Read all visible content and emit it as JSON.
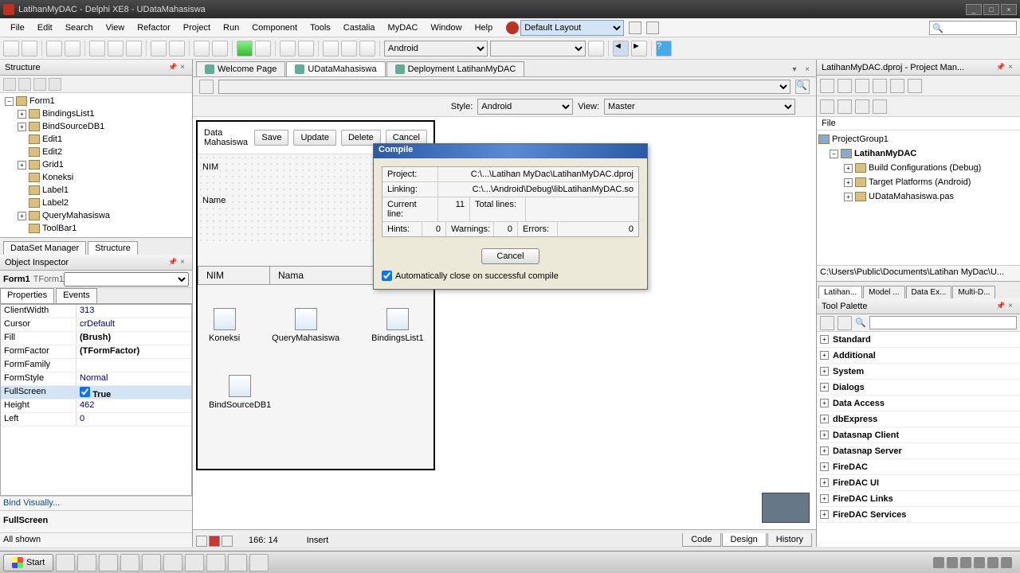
{
  "window_title": "LatihanMyDAC - Delphi XE8 - UDataMahasiswa",
  "menus": [
    "File",
    "Edit",
    "Search",
    "View",
    "Refactor",
    "Project",
    "Run",
    "Component",
    "Tools",
    "Castalia",
    "MyDAC",
    "Window",
    "Help"
  ],
  "layout_combo": "Default Layout",
  "target_combo": "Android",
  "structure": {
    "title": "Structure",
    "root": "Form1",
    "items": [
      "BindingsList1",
      "BindSourceDB1",
      "Edit1",
      "Edit2",
      "Grid1",
      "Koneksi",
      "Label1",
      "Label2",
      "QueryMahasiswa",
      "ToolBar1"
    ],
    "tabs": [
      "DataSet Manager",
      "Structure"
    ]
  },
  "inspector": {
    "title": "Object Inspector",
    "obj_name": "Form1",
    "obj_type": "TForm1",
    "tabs": [
      "Properties",
      "Events"
    ],
    "props": [
      {
        "n": "ClientWidth",
        "v": "313"
      },
      {
        "n": "Cursor",
        "v": "crDefault"
      },
      {
        "n": "Fill",
        "v": "(Brush)",
        "b": true
      },
      {
        "n": "FormFactor",
        "v": "(TFormFactor)",
        "b": true
      },
      {
        "n": "FormFamily",
        "v": ""
      },
      {
        "n": "FormStyle",
        "v": "Normal"
      },
      {
        "n": "FullScreen",
        "v": "True",
        "sel": true,
        "b": true,
        "chk": true
      },
      {
        "n": "Height",
        "v": "462"
      },
      {
        "n": "Left",
        "v": "0"
      }
    ],
    "bind_link": "Bind Visually...",
    "selected_prop": "FullScreen",
    "status": "All shown"
  },
  "tabs_top": [
    {
      "label": "Welcome Page",
      "icon": "home-icon"
    },
    {
      "label": "UDataMahasiswa",
      "icon": "unit-icon",
      "active": true
    },
    {
      "label": "Deployment LatihanMyDAC",
      "icon": "deploy-icon"
    }
  ],
  "style_bar": {
    "style_label": "Style:",
    "style_val": "Android",
    "view_label": "View:",
    "view_val": "Master"
  },
  "form": {
    "title": "Data Mahasiswa",
    "buttons": [
      "Save",
      "Update",
      "Delete",
      "Cancel"
    ],
    "labels": [
      "NIM",
      "Name"
    ],
    "grid_cols": [
      "NIM",
      "Nama"
    ],
    "components": [
      "Koneksi",
      "QueryMahasiswa",
      "BindingsList1",
      "BindSourceDB1"
    ]
  },
  "designer_status": {
    "pos": "166: 14",
    "mode": "Insert"
  },
  "designer_tabs": [
    "Code",
    "Design",
    "History"
  ],
  "project": {
    "title": "LatihanMyDAC.dproj - Project Man...",
    "file_label": "File",
    "root": "ProjectGroup1",
    "proj": "LatihanMyDAC",
    "children": [
      "Build Configurations (Debug)",
      "Target Platforms (Android)",
      "UDataMahasiswa.pas"
    ],
    "path": "C:\\Users\\Public\\Documents\\Latihan MyDac\\U...",
    "tabs": [
      "Latihan...",
      "Model ...",
      "Data Ex...",
      "Multi-D..."
    ]
  },
  "palette": {
    "title": "Tool Palette",
    "cats": [
      "Standard",
      "Additional",
      "System",
      "Dialogs",
      "Data Access",
      "dbExpress",
      "Datasnap Client",
      "Datasnap Server",
      "FireDAC",
      "FireDAC UI",
      "FireDAC Links",
      "FireDAC Services"
    ]
  },
  "dialog": {
    "title": "Compile",
    "rows1": [
      {
        "l": "Project:",
        "v": "C:\\...\\Latihan MyDac\\LatihanMyDAC.dproj"
      },
      {
        "l": "Linking:",
        "v": "C:\\...\\Android\\Debug\\libLatihanMyDAC.so"
      }
    ],
    "rows2": [
      {
        "l": "Current line:",
        "v": "11",
        "l2": "Total lines:",
        "v2": ""
      },
      {
        "l": "Hints:",
        "v": "0",
        "l2": "Warnings:",
        "v2": "0",
        "l3": "Errors:",
        "v3": "0"
      }
    ],
    "cancel": "Cancel",
    "autoclose": "Automatically close on successful compile"
  },
  "taskbar": {
    "start": "Start",
    "time": "..."
  }
}
